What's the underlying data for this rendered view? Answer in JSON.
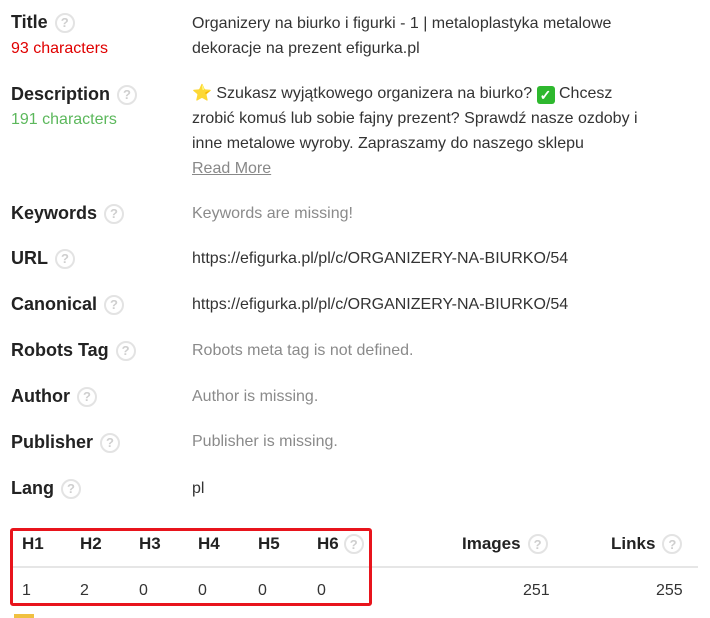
{
  "title": {
    "label": "Title",
    "count": "93 characters",
    "value_line1": "Organizery na biurko i figurki - 1 | metaloplastyka metalowe",
    "value_line2": "dekoracje na prezent efigurka.pl"
  },
  "description": {
    "label": "Description",
    "count": "191 characters",
    "star": "⭐",
    "line1a": " Szukasz wyjątkowego organizera na biurko? ",
    "check": "✓",
    "line1b": " Chcesz",
    "line2": "zrobić komuś lub sobie fajny prezent? Sprawdź nasze ozdoby i",
    "line3": "inne metalowe wyroby. Zapraszamy do naszego sklepu",
    "read_more": "Read More"
  },
  "keywords": {
    "label": "Keywords",
    "value": "Keywords are missing!"
  },
  "url": {
    "label": "URL",
    "value": "https://efigurka.pl/pl/c/ORGANIZERY-NA-BIURKO/54"
  },
  "canonical": {
    "label": "Canonical",
    "value": "https://efigurka.pl/pl/c/ORGANIZERY-NA-BIURKO/54"
  },
  "robots": {
    "label": "Robots Tag",
    "value": "Robots meta tag is not defined."
  },
  "author": {
    "label": "Author",
    "value": "Author is missing."
  },
  "publisher": {
    "label": "Publisher",
    "value": "Publisher is missing."
  },
  "lang": {
    "label": "Lang",
    "value": "pl"
  },
  "help_glyph": "?",
  "headings": {
    "labels": [
      "H1",
      "H2",
      "H3",
      "H4",
      "H5",
      "H6"
    ],
    "values": [
      "1",
      "2",
      "0",
      "0",
      "0",
      "0"
    ]
  },
  "images": {
    "label": "Images",
    "value": "251"
  },
  "links": {
    "label": "Links",
    "value": "255"
  },
  "colors": {
    "count_bad": "#e00000",
    "count_good": "#5cb85c",
    "highlight_box": "#e8141c"
  }
}
